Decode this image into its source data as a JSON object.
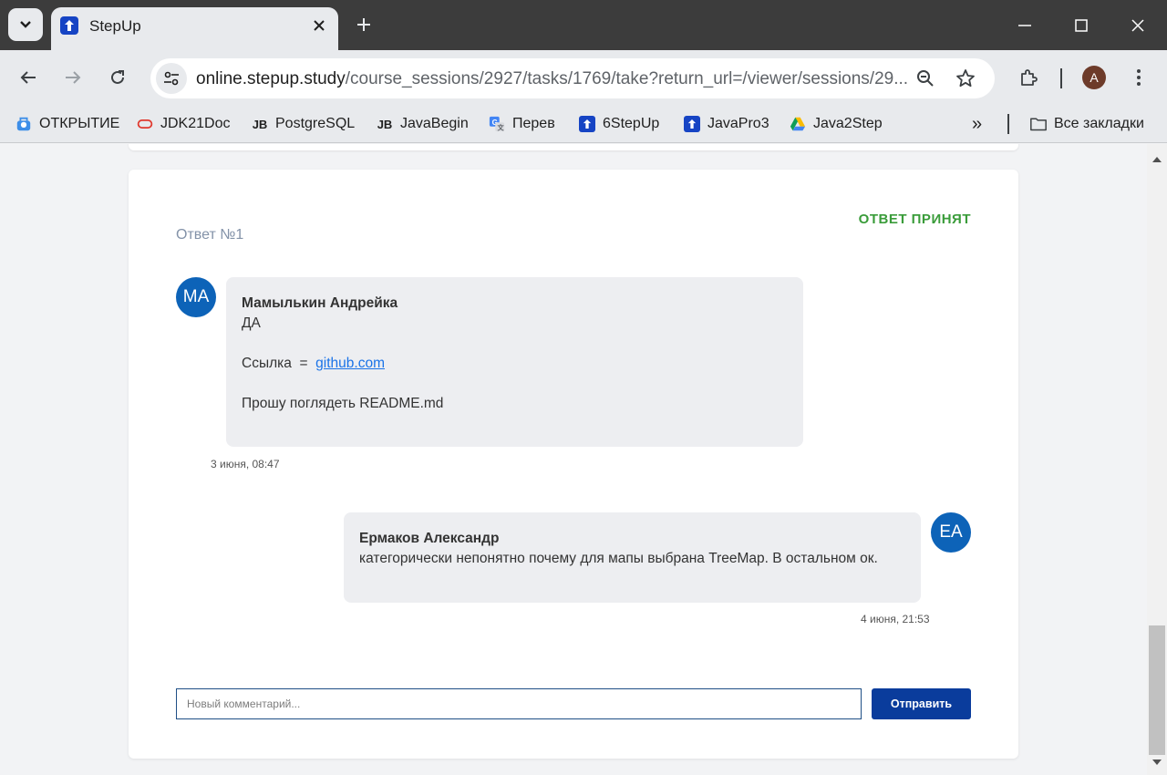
{
  "browser": {
    "tab_title": "StepUp",
    "url_host": "online.stepup.study",
    "url_path": "/course_sessions/2927/tasks/1769/take?return_url=/viewer/sessions/29...",
    "profile_initial": "A",
    "bookmarks": [
      {
        "label": "ОТКРЫТИЕ",
        "icon": "bank-icon"
      },
      {
        "label": "JDK21Doc",
        "icon": "oracle-icon"
      },
      {
        "label": "PostgreSQL",
        "icon": "jb-icon"
      },
      {
        "label": "JavaBegin",
        "icon": "jb-icon"
      },
      {
        "label": "Перев",
        "icon": "translate-icon"
      },
      {
        "label": "6StepUp",
        "icon": "stepup-icon"
      },
      {
        "label": "JavaPro3",
        "icon": "stepup-icon"
      },
      {
        "label": "Java2Step",
        "icon": "drive-icon"
      }
    ],
    "all_bookmarks_label": "Все закладки",
    "more_bookmarks": "»"
  },
  "answer": {
    "title": "Ответ №1",
    "status": "ОТВЕТ ПРИНЯТ",
    "status_color": "#3a9c3a"
  },
  "messages": [
    {
      "initials": "МА",
      "author": "Мамылькин Андрейка",
      "line1": "ДА",
      "link_prefix": "Ссылка  =",
      "link_text": "github.com",
      "line3": "Прошу поглядеть README.md",
      "time": "3 июня, 08:47"
    },
    {
      "initials": "ЕА",
      "author": "Ермаков Александр",
      "text": "категорически непонятно почему для мапы выбрана TreeMap. В остальном ок.",
      "time": "4 июня, 21:53"
    }
  ],
  "comment": {
    "placeholder": "Новый комментарий...",
    "send_label": "Отправить"
  },
  "colors": {
    "accent": "#0a3c9c",
    "avatar": "#0d63b8",
    "link": "#1a73e8"
  }
}
